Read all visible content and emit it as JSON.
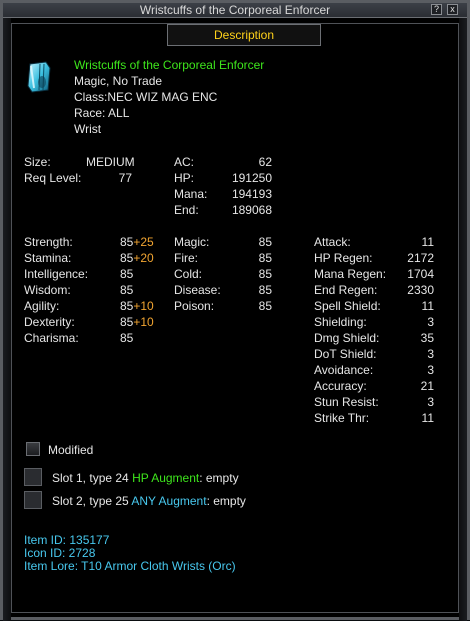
{
  "window": {
    "title": "Wristcuffs of the Corporeal Enforcer",
    "help_label": "?",
    "close_label": "x"
  },
  "panel_header": "Description",
  "item": {
    "name": "Wristcuffs of the Corporeal Enforcer",
    "flags": "Magic, No Trade",
    "class": "Class:NEC WIZ MAG ENC",
    "race": "Race:  ALL",
    "slot": "Wrist"
  },
  "basic": {
    "size_label": "Size:",
    "size_value": "MEDIUM",
    "req_label": "Req Level:",
    "req_value": "77",
    "ac_label": "AC:",
    "ac_value": "62",
    "hp_label": "HP:",
    "hp_value": "191250",
    "mana_label": "Mana:",
    "mana_value": "194193",
    "end_label": "End:",
    "end_value": "189068"
  },
  "stats": [
    {
      "label": "Strength:",
      "base": "85",
      "bonus": "+25"
    },
    {
      "label": "Stamina:",
      "base": "85",
      "bonus": "+20"
    },
    {
      "label": "Intelligence:",
      "base": "85",
      "bonus": ""
    },
    {
      "label": "Wisdom:",
      "base": "85",
      "bonus": ""
    },
    {
      "label": "Agility:",
      "base": "85",
      "bonus": "+10"
    },
    {
      "label": "Dexterity:",
      "base": "85",
      "bonus": "+10"
    },
    {
      "label": "Charisma:",
      "base": "85",
      "bonus": ""
    }
  ],
  "resists": [
    {
      "label": "Magic:",
      "value": "85"
    },
    {
      "label": "Fire:",
      "value": "85"
    },
    {
      "label": "Cold:",
      "value": "85"
    },
    {
      "label": "Disease:",
      "value": "85"
    },
    {
      "label": "Poison:",
      "value": "85"
    }
  ],
  "mods": [
    {
      "label": "Attack:",
      "value": "11"
    },
    {
      "label": "HP Regen:",
      "value": "2172"
    },
    {
      "label": "Mana Regen:",
      "value": "1704"
    },
    {
      "label": "End Regen:",
      "value": "2330"
    },
    {
      "label": "Spell Shield:",
      "value": "11"
    },
    {
      "label": "Shielding:",
      "value": "3"
    },
    {
      "label": "Dmg Shield:",
      "value": "35"
    },
    {
      "label": "DoT Shield:",
      "value": "3"
    },
    {
      "label": "Avoidance:",
      "value": "3"
    },
    {
      "label": "Accuracy:",
      "value": "21"
    },
    {
      "label": "Stun Resist:",
      "value": "3"
    },
    {
      "label": "Strike Thr:",
      "value": "11"
    }
  ],
  "modified_label": "Modified",
  "slots": [
    {
      "prefix": "Slot 1, type 24 ",
      "type": "HP Augment",
      "suffix": ": empty"
    },
    {
      "prefix": "Slot 2, type 25 ",
      "type": "ANY Augment",
      "suffix": ": empty"
    }
  ],
  "info": {
    "item_id": "Item ID: 135177",
    "icon_id": "Icon ID: 2728",
    "item_lore": "Item Lore: T10 Armor Cloth Wrists (Orc)"
  },
  "colors": {
    "name": "#3ee61c",
    "bonus": "#f2a531",
    "augment_hp": "#3ee61c",
    "augment_any": "#48c8ee",
    "info": "#48c8ee",
    "header": "#ffd21a"
  },
  "icons": {
    "item_icon": "wristcuff-icon"
  }
}
